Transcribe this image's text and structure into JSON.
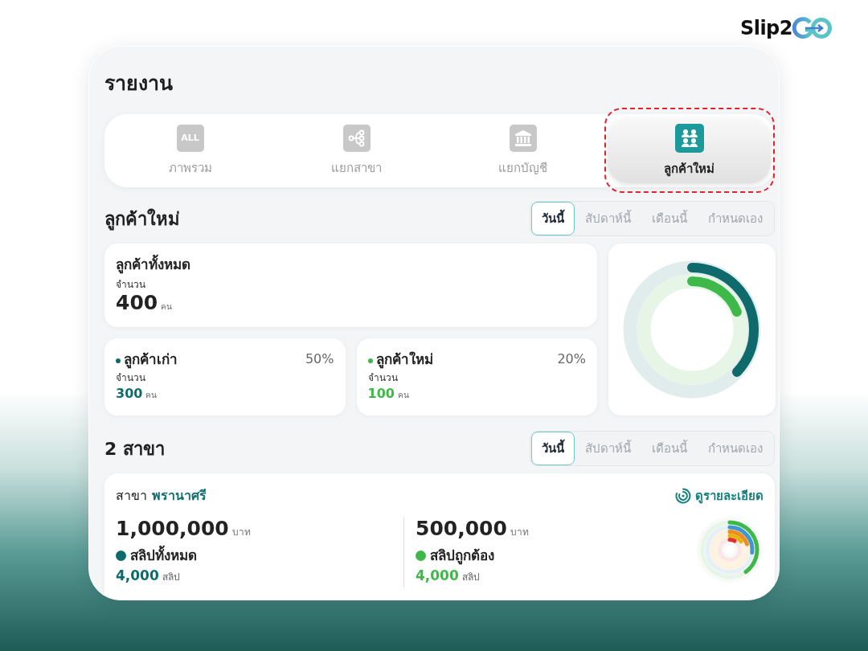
{
  "brand": {
    "name": "Slip2"
  },
  "report": {
    "title": "รายงาน",
    "tabs": [
      {
        "kind": "all",
        "icon_text": "ALL",
        "label": "ภาพรวม",
        "selected": false,
        "highlighted": false
      },
      {
        "kind": "branch",
        "label": "แยกสาขา",
        "selected": false,
        "highlighted": false
      },
      {
        "kind": "account",
        "label": "แยกบัญชี",
        "selected": false,
        "highlighted": false
      },
      {
        "kind": "customers",
        "label": "ลูกค้าใหม่",
        "selected": true,
        "highlighted": true
      }
    ]
  },
  "new_customers": {
    "title": "ลูกค้าใหม่",
    "periods": [
      {
        "label": "วันนี้",
        "selected": true
      },
      {
        "label": "สัปดาห์นี้",
        "selected": false
      },
      {
        "label": "เดือนนี้",
        "selected": false
      },
      {
        "label": "กำหนดเอง",
        "selected": false
      }
    ],
    "total": {
      "title": "ลูกค้าทั้งหมด",
      "count_label": "จำนวน",
      "value": "400",
      "unit": "คน"
    },
    "segments": [
      {
        "title": "ลูกค้าเก่า",
        "percent": "50%",
        "count_label": "จำนวน",
        "value": "300",
        "unit": "คน",
        "color": "#0f6b6b",
        "level": 0.37
      },
      {
        "title": "ลูกค้าใหม่",
        "percent": "20%",
        "count_label": "จำนวน",
        "value": "100",
        "unit": "คน",
        "color": "#3db849",
        "level": 0.19
      }
    ]
  },
  "branches": {
    "title": "2 สาขา",
    "periods": [
      {
        "label": "วันนี้",
        "selected": true
      },
      {
        "label": "สัปดาห์นี้",
        "selected": false
      },
      {
        "label": "เดือนนี้",
        "selected": false
      },
      {
        "label": "กำหนดเอง",
        "selected": false
      }
    ],
    "branch": {
      "prefix": "สาขา",
      "name": "พรานาศรี",
      "link": "ดูรายละเอียด",
      "stats": [
        {
          "amount": "1,000,000",
          "currency": "บาท",
          "label": "สลิปทั้งหมด",
          "value": "4,000",
          "unit": "สลิป",
          "color": "#0f6b6b"
        },
        {
          "amount": "500,000",
          "currency": "บาท",
          "label": "สลิปถูกต้อง",
          "value": "4,000",
          "unit": "สลิป",
          "color": "#3db849"
        }
      ]
    }
  }
}
